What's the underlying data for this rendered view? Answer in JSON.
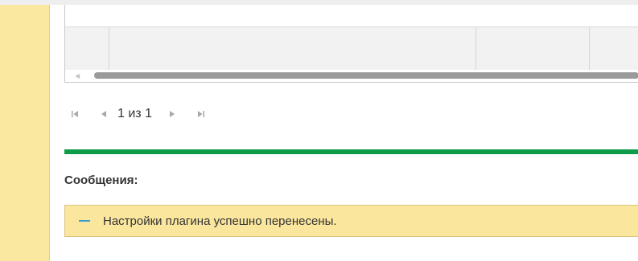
{
  "pager": {
    "first_icon": "first-page-icon",
    "prev_icon": "previous-page-icon",
    "status": "1 из 1",
    "next_icon": "next-page-icon",
    "last_icon": "last-page-icon"
  },
  "messages": {
    "title": "Сообщения:",
    "items": [
      {
        "text": "Настройки плагина успешно перенесены.",
        "icon": "dash-icon"
      }
    ]
  },
  "colors": {
    "sidebar": "#fae7a0",
    "divider": "#0e9b4a",
    "message_bg": "#fbe69e",
    "message_dash": "#3a9bd1"
  }
}
